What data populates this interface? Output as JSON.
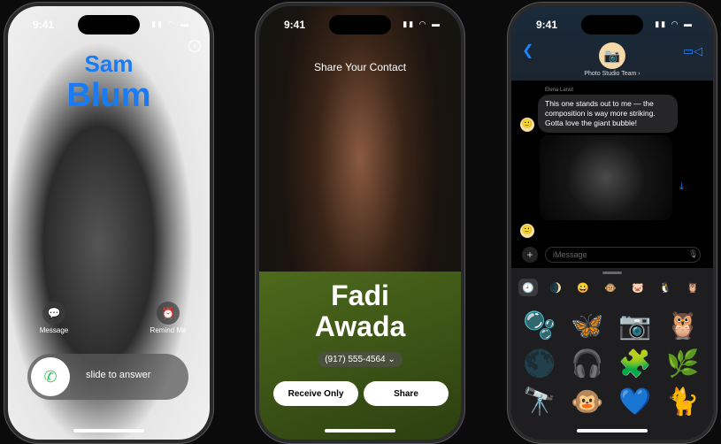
{
  "status": {
    "time": "9:41"
  },
  "phone1": {
    "first_name": "Sam",
    "last_name": "Blum",
    "message_label": "Message",
    "remind_label": "Remind Me",
    "slide_text": "slide to answer",
    "icons": [
      "info-icon",
      "message-icon",
      "alarm-icon",
      "phone-icon"
    ]
  },
  "phone2": {
    "title": "Share Your Contact",
    "first_name": "Fadi",
    "last_name": "Awada",
    "phone_number": "(917) 555-4564",
    "receive_only": "Receive Only",
    "share": "Share"
  },
  "phone3": {
    "group_name": "Photo Studio Team ›",
    "sender": "Elena Lanot",
    "message": "This one stands out to me — the composition is way more striking. Gotta love the giant bubble!",
    "input_placeholder": "iMessage",
    "accent": "#1a84ff",
    "tray_tabs": [
      "🕘",
      "🌒",
      "😀",
      "🐵",
      "🐷",
      "🐧",
      "🦉",
      "🔴"
    ],
    "stickers": [
      "🫧",
      "🦋",
      "📷",
      "🦉",
      "🌑",
      "🎧",
      "🧩",
      "🌿",
      "🔭",
      "🐵",
      "💙",
      "🐈"
    ]
  }
}
